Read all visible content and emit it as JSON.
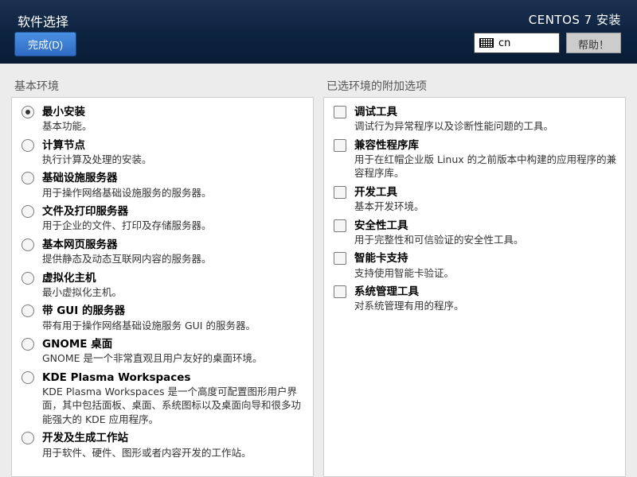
{
  "header": {
    "title": "软件选择",
    "done_label": "完成(D)",
    "installer_title": "CENTOS 7 安装",
    "lang_code": "cn",
    "help_label": "帮助！"
  },
  "left": {
    "pane_title": "基本环境",
    "items": [
      {
        "name": "最小安装",
        "desc": "基本功能。",
        "selected": true
      },
      {
        "name": "计算节点",
        "desc": "执行计算及处理的安装。",
        "selected": false
      },
      {
        "name": "基础设施服务器",
        "desc": "用于操作网络基础设施服务的服务器。",
        "selected": false
      },
      {
        "name": "文件及打印服务器",
        "desc": "用于企业的文件、打印及存储服务器。",
        "selected": false
      },
      {
        "name": "基本网页服务器",
        "desc": "提供静态及动态互联网内容的服务器。",
        "selected": false
      },
      {
        "name": "虚拟化主机",
        "desc": "最小虚拟化主机。",
        "selected": false
      },
      {
        "name": "带 GUI 的服务器",
        "desc": "带有用于操作网络基础设施服务 GUI 的服务器。",
        "selected": false
      },
      {
        "name": "GNOME 桌面",
        "desc": "GNOME 是一个非常直观且用户友好的桌面环境。",
        "selected": false
      },
      {
        "name": "KDE Plasma Workspaces",
        "desc": "KDE Plasma Workspaces 是一个高度可配置图形用户界面，其中包括面板、桌面、系统图标以及桌面向导和很多功能强大的 KDE 应用程序。",
        "selected": false
      },
      {
        "name": "开发及生成工作站",
        "desc": "用于软件、硬件、图形或者内容开发的工作站。",
        "selected": false
      }
    ]
  },
  "right": {
    "pane_title": "已选环境的附加选项",
    "items": [
      {
        "name": "调试工具",
        "desc": "调试行为异常程序以及诊断性能问题的工具。",
        "selected": false
      },
      {
        "name": "兼容性程序库",
        "desc": "用于在红帽企业版 Linux 的之前版本中构建的应用程序的兼容程序库。",
        "selected": false
      },
      {
        "name": "开发工具",
        "desc": "基本开发环境。",
        "selected": false
      },
      {
        "name": "安全性工具",
        "desc": "用于完整性和可信验证的安全性工具。",
        "selected": false
      },
      {
        "name": "智能卡支持",
        "desc": "支持使用智能卡验证。",
        "selected": false
      },
      {
        "name": "系统管理工具",
        "desc": "对系统管理有用的程序。",
        "selected": false
      }
    ]
  }
}
